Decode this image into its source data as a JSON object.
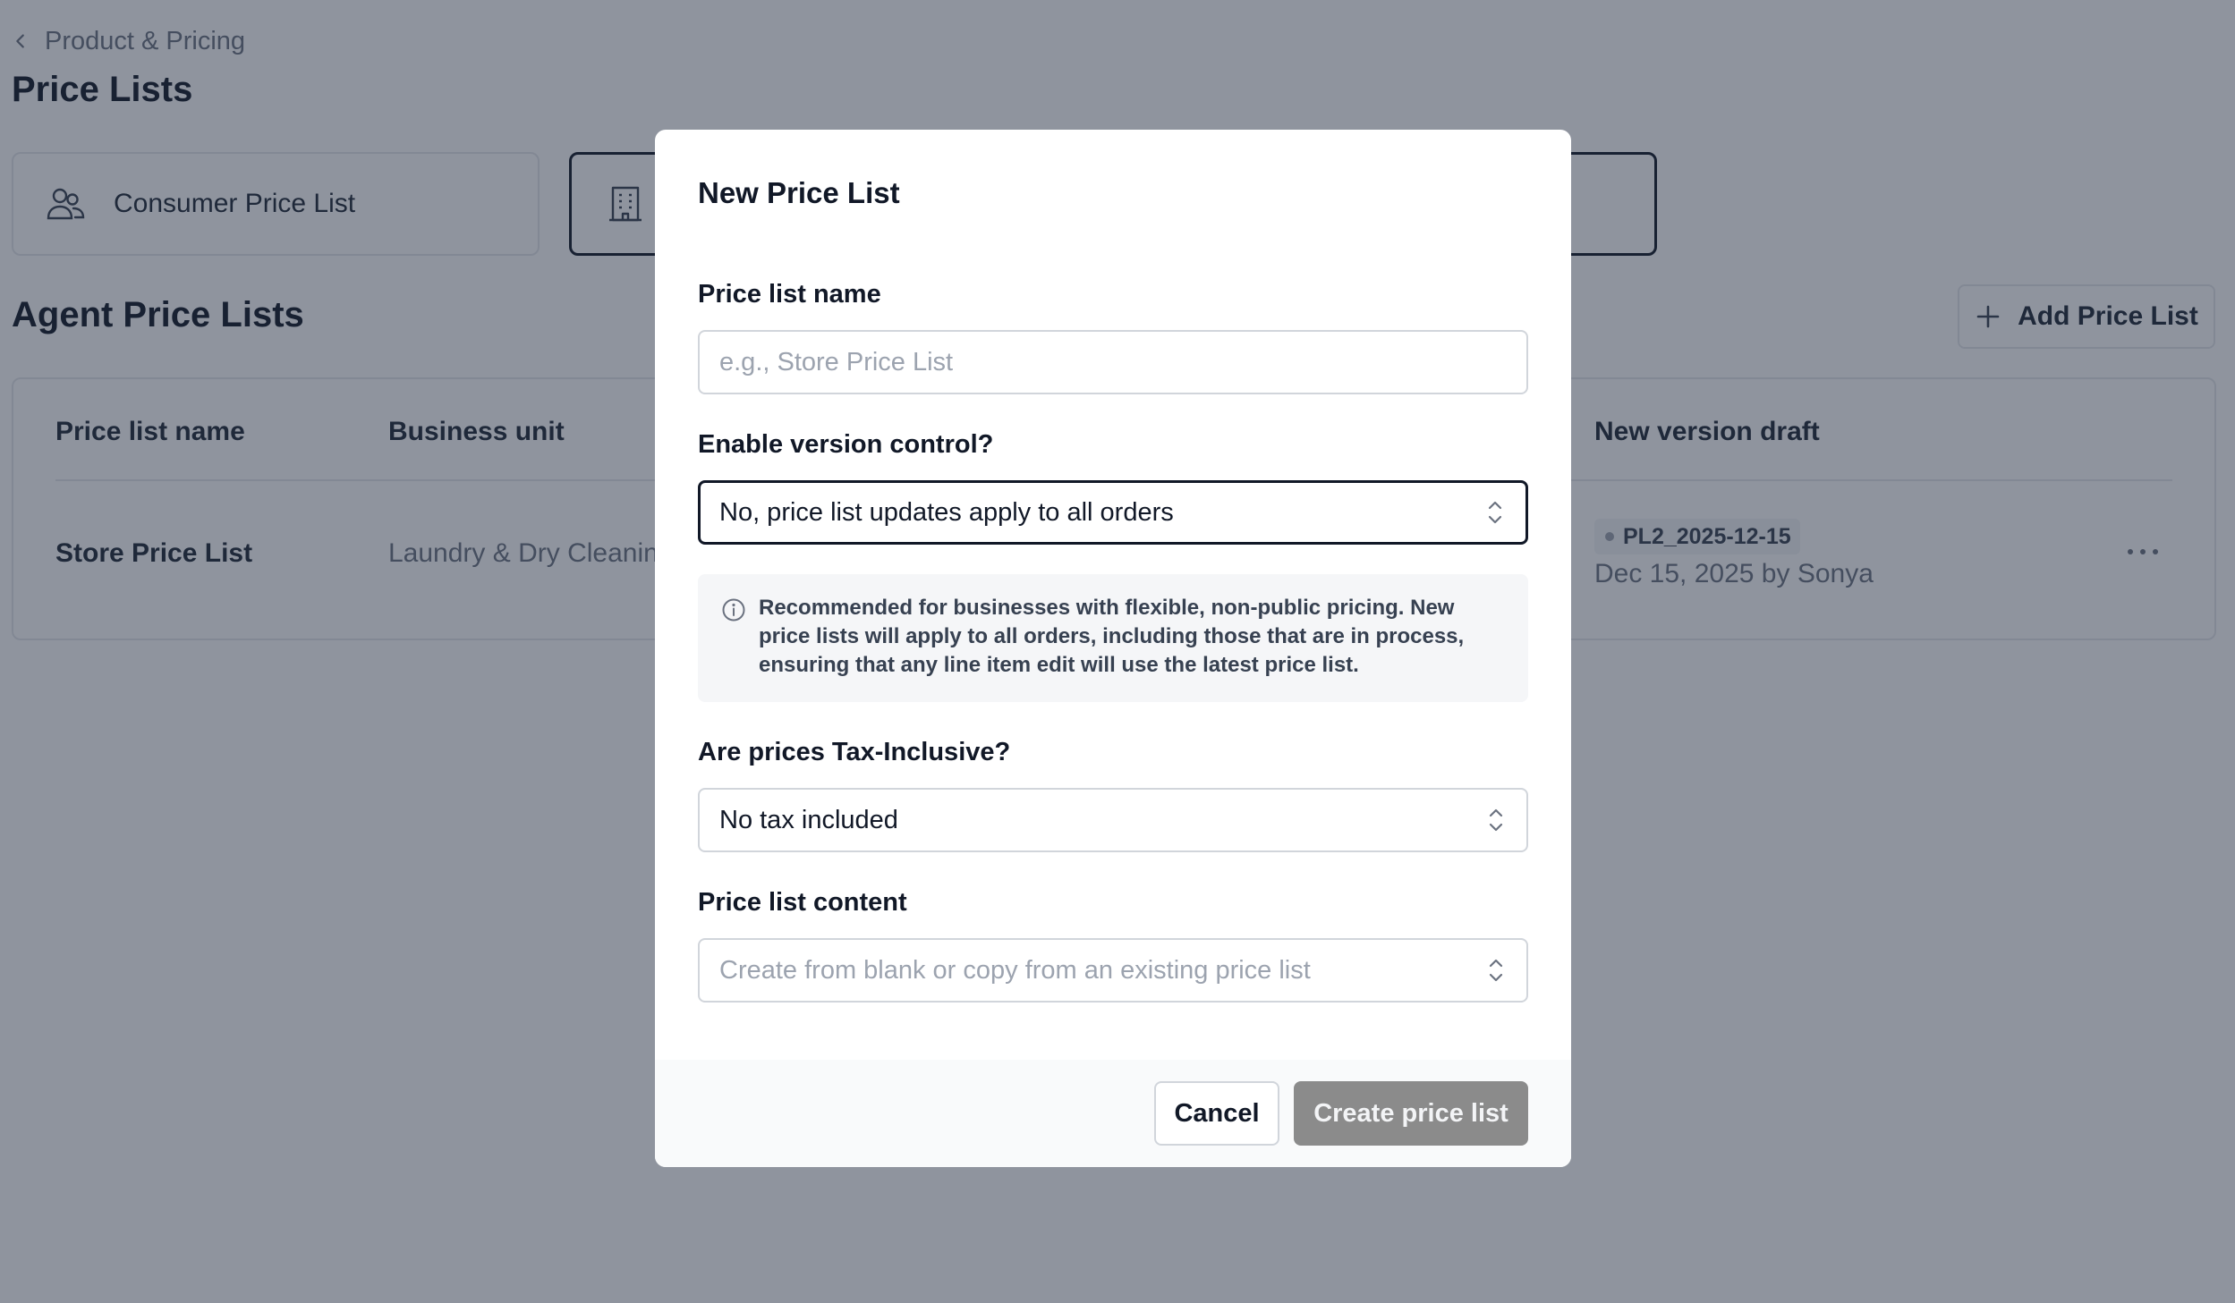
{
  "breadcrumb": {
    "label": "Product & Pricing"
  },
  "page": {
    "title": "Price Lists"
  },
  "cards": {
    "consumer": {
      "label": "Consumer Price List"
    },
    "agent": {
      "label": ""
    }
  },
  "section": {
    "title": "Agent Price Lists",
    "add_button": "Add Price List"
  },
  "table": {
    "headers": {
      "name": "Price list name",
      "unit": "Business unit",
      "draft": "New version draft"
    },
    "rows": [
      {
        "name": "Store Price List",
        "unit": "Laundry & Dry Cleaning",
        "draft_tag": "PL2_2025-12-15",
        "draft_date": "Dec 15, 2025 by Sonya"
      }
    ]
  },
  "modal": {
    "title": "New Price List",
    "name_field": {
      "label": "Price list name",
      "value": "",
      "placeholder": "e.g., Store Price List"
    },
    "version_field": {
      "label": "Enable version control?",
      "value": "No, price list updates apply to all orders"
    },
    "info": {
      "text": "Recommended for businesses with flexible, non-public pricing. New price lists will apply to all orders, including those that are in process, ensuring that any line item edit will use the latest price list."
    },
    "tax_field": {
      "label": "Are prices Tax-Inclusive?",
      "value": "No tax included"
    },
    "content_field": {
      "label": "Price list content",
      "placeholder": "Create from blank or copy from an existing price list"
    },
    "cancel_label": "Cancel",
    "create_label": "Create price list"
  },
  "icons": {
    "back": "chevron-left-icon",
    "consumer": "users-icon",
    "agent": "building-icon",
    "add": "plus-icon",
    "more": "more-horizontal-icon",
    "info": "info-icon",
    "select": "chevron-up-down-icon"
  }
}
